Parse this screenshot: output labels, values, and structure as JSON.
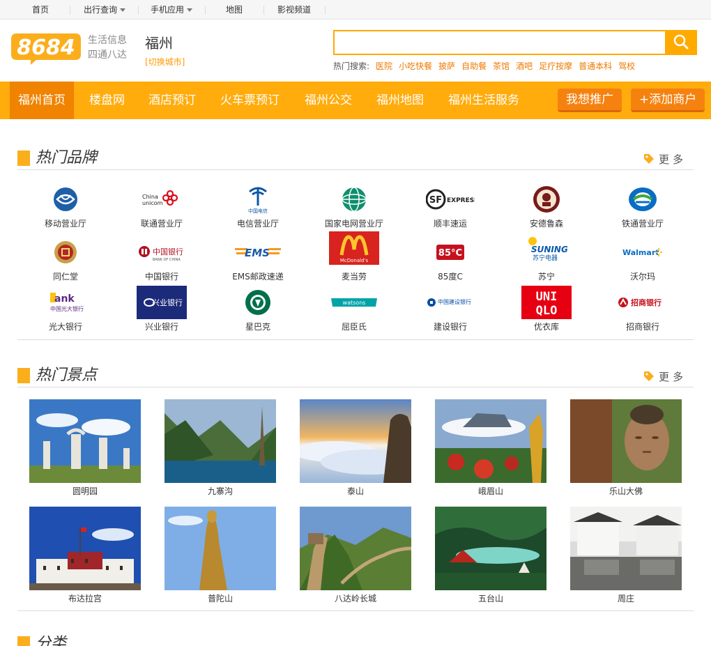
{
  "topbar": {
    "items": [
      {
        "label": "首页"
      },
      {
        "label": "出行查询"
      },
      {
        "label": "手机应用"
      },
      {
        "label": "地图"
      },
      {
        "label": "影视频道"
      }
    ]
  },
  "header": {
    "logo_text": "8684",
    "slogan_1": "生活信息",
    "slogan_2": "四通八达",
    "city": "福州",
    "switch_city": "[切换城市]",
    "search_value": "",
    "hot_label": "热门搜索:",
    "hot_keywords": [
      "医院",
      "小吃快餐",
      "披萨",
      "自助餐",
      "茶馆",
      "酒吧",
      "足疗按摩",
      "普通本科",
      "驾校"
    ]
  },
  "nav": {
    "items": [
      {
        "label": "福州首页"
      },
      {
        "label": "楼盘网"
      },
      {
        "label": "酒店预订"
      },
      {
        "label": "火车票预订"
      },
      {
        "label": "福州公交"
      },
      {
        "label": "福州地图"
      },
      {
        "label": "福州生活服务"
      }
    ],
    "promote_label": "我想推广",
    "add_merchant_label": "+添加商户"
  },
  "brands": {
    "title": "热门品牌",
    "more": "更多",
    "items": [
      {
        "name": "移动营业厅",
        "icon": "china-mobile-logo"
      },
      {
        "name": "联通营业厅",
        "icon": "china-unicom-logo"
      },
      {
        "name": "电信营业厅",
        "icon": "china-telecom-logo"
      },
      {
        "name": "国家电网营业厅",
        "icon": "state-grid-logo"
      },
      {
        "name": "顺丰速运",
        "icon": "sf-express-logo"
      },
      {
        "name": "安德鲁森",
        "icon": "andersen-logo"
      },
      {
        "name": "铁通营业厅",
        "icon": "china-tietong-logo"
      },
      {
        "name": "同仁堂",
        "icon": "tongrentang-logo"
      },
      {
        "name": "中国银行",
        "icon": "bank-of-china-logo"
      },
      {
        "name": "EMS邮政速递",
        "icon": "ems-logo"
      },
      {
        "name": "麦当劳",
        "icon": "mcdonalds-logo"
      },
      {
        "name": "85度C",
        "icon": "85c-logo"
      },
      {
        "name": "苏宁",
        "icon": "suning-logo"
      },
      {
        "name": "沃尔玛",
        "icon": "walmart-logo"
      },
      {
        "name": "光大银行",
        "icon": "everbright-bank-logo"
      },
      {
        "name": "兴业银行",
        "icon": "industrial-bank-logo"
      },
      {
        "name": "星巴克",
        "icon": "starbucks-logo"
      },
      {
        "name": "屈臣氏",
        "icon": "watsons-logo"
      },
      {
        "name": "建设银行",
        "icon": "ccb-logo"
      },
      {
        "name": "优衣库",
        "icon": "uniqlo-logo"
      },
      {
        "name": "招商银行",
        "icon": "cmb-logo"
      }
    ]
  },
  "spots": {
    "title": "热门景点",
    "more": "更多",
    "items": [
      {
        "name": "圆明园"
      },
      {
        "name": "九寨沟"
      },
      {
        "name": "泰山"
      },
      {
        "name": "峨眉山"
      },
      {
        "name": "乐山大佛"
      },
      {
        "name": "布达拉宫"
      },
      {
        "name": "普陀山"
      },
      {
        "name": "八达岭长城"
      },
      {
        "name": "五台山"
      },
      {
        "name": "周庄"
      }
    ]
  },
  "category": {
    "title": "分类"
  },
  "colors": {
    "accent": "#ffac0c",
    "nav_active": "#f08300",
    "link_orange": "#f07800"
  }
}
